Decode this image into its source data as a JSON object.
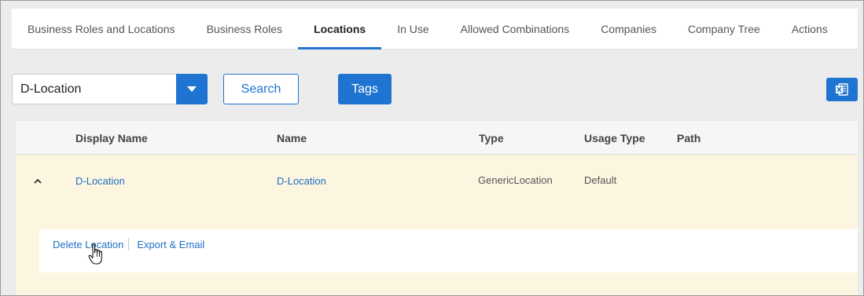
{
  "tabs": [
    {
      "label": "Business Roles and Locations",
      "active": false
    },
    {
      "label": "Business Roles",
      "active": false
    },
    {
      "label": "Locations",
      "active": true
    },
    {
      "label": "In Use",
      "active": false
    },
    {
      "label": "Allowed Combinations",
      "active": false
    },
    {
      "label": "Companies",
      "active": false
    },
    {
      "label": "Company Tree",
      "active": false
    },
    {
      "label": "Actions",
      "active": false
    }
  ],
  "toolbar": {
    "select_value": "D-Location",
    "search_label": "Search",
    "tags_label": "Tags",
    "export_icon": "excel-icon"
  },
  "table": {
    "headers": {
      "display_name": "Display Name",
      "name": "Name",
      "type": "Type",
      "usage_type": "Usage Type",
      "path": "Path"
    },
    "rows": [
      {
        "display_name": "D-Location",
        "name": "D-Location",
        "type": "GenericLocation",
        "usage_type": "Default",
        "path": "",
        "expanded": true
      }
    ],
    "detail_actions": {
      "delete_label": "Delete Location",
      "export_label": "Export & Email"
    }
  },
  "colors": {
    "accent": "#1f74d1",
    "row_highlight": "#fcf5e0",
    "header_bg": "#f5f6f8",
    "page_bg": "#ececec"
  }
}
